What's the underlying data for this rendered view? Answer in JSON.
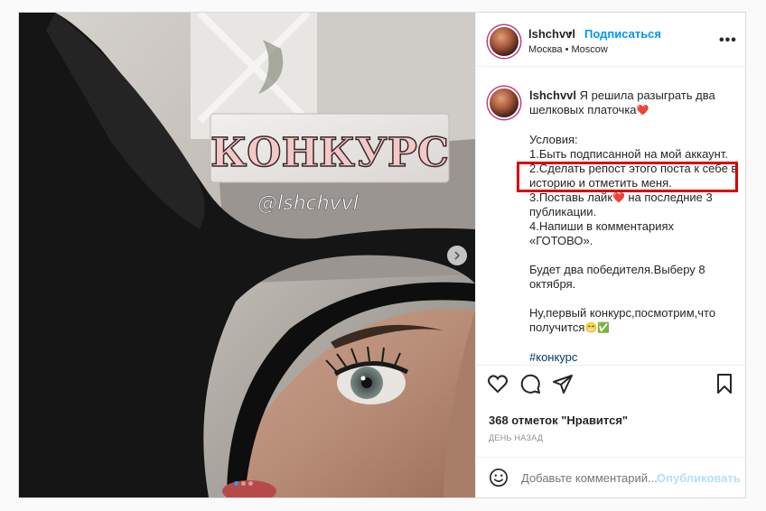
{
  "header": {
    "username": "lshchvvl",
    "bullet": "•",
    "follow_label": "Подписаться",
    "location": "Москва • Moscow",
    "more": "•••"
  },
  "media": {
    "title": "КОНКУРС",
    "handle": "@lshchvvl",
    "carousel_count": 3,
    "carousel_active": 0
  },
  "caption": {
    "username": "lshchvvl",
    "intro": "Я решила разыграть два шелковых платочка",
    "heart": "❤️",
    "conditions_title": "Условия:",
    "rule1": "1.Быть подписанной на мой аккаунт.",
    "rule2": "2.Сделать репост этого поста к себе в историю и отметить меня.",
    "rule3_a": "3.Поставь лайк",
    "rule3_b": " на последние 3 публикации.",
    "rule4": "4.Напиши в комментариях «ГОТОВО».",
    "winners": "Будет два победителя.Выберу 8 октября.",
    "closing": "Ну,первый конкурс,посмотрим,что получится",
    "closing_emoji": "😁✅",
    "hashtag": "#конкурс",
    "trailing": "."
  },
  "actions": {
    "like_icon": "heart-icon",
    "comment_icon": "comment-icon",
    "share_icon": "share-icon",
    "save_icon": "bookmark-icon"
  },
  "likes_text": "368 отметок \"Нравится\"",
  "time_text": "ДЕНЬ НАЗАД",
  "add_comment": {
    "placeholder": "Добавьте комментарий...",
    "post_label": "Опубликовать"
  },
  "colors": {
    "follow": "#0095f6",
    "highlight": "#d80000",
    "post_disabled": "#b2dffc"
  }
}
